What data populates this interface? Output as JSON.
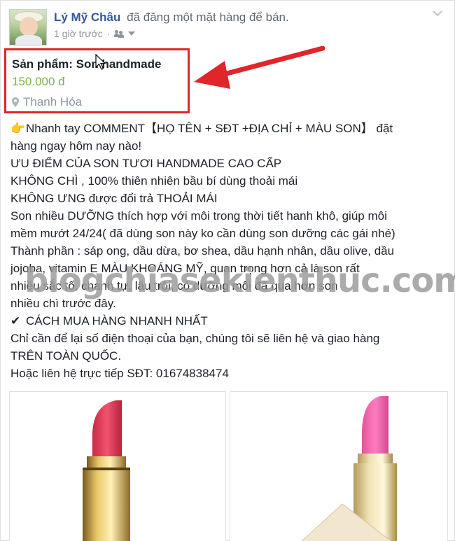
{
  "post": {
    "author": "Lý Mỹ Châu",
    "action": "đã đăng một mặt hàng để bán.",
    "time": "1 giờ trước",
    "separator": "·"
  },
  "product": {
    "title": "Sản phẩm: Son handmade",
    "price": "150.000 đ",
    "location": "Thanh Hóa"
  },
  "body_lines": [
    "Nhanh tay COMMENT【HỌ TÊN + SĐT +ĐỊA CHỈ + MÀU SON】 đặt",
    "hàng ngay hôm nay nào!",
    "ƯU ĐIỂM CỦA SON TƯƠI HANDMADE CAO CẤP",
    "KHÔNG CHÌ , 100% thiên nhiên bầu bí dùng thoải mái",
    "KHÔNG ƯNG được đổi trả THOẢI MÁI",
    "Son nhiều DƯỠNG thích hợp với môi trong thời tiết hanh khô, giúp môi",
    "mềm mướt 24/24( đã dùng son này ko cần dùng son dưỡng các gái nhé)",
    "Thành phần : sáp ong, dầu dừa, bơ shea, dầu hạnh nhân, dầu olive, dầu",
    "jojoba, vitamin E MÀU KHOÁNG MỸ, quan trọng hơn cả là son rất",
    "nhiều sắc tố, chanh tự, lâu trôi, có dưỡng môi đã qua hơn son",
    "nhiều chì trước đây.",
    "CÁCH MUA HÀNG NHANH NHẤT",
    "Chỉ cần để lại số điện thoại của bạn, chúng tôi sẽ liên hệ và giao hàng",
    "TRÊN TOÀN QUỐC.",
    "Hoặc liên hệ trực tiếp SĐT: 01674838474"
  ],
  "watermark": "blogchiasekienthuc.com",
  "icons": {
    "pointing": "pointing-hand-icon",
    "check": "check-mark-icon",
    "location": "location-pin-icon",
    "audience": "friends-icon",
    "menu": "chevron-down-icon"
  },
  "colors": {
    "name": "#365899",
    "price": "#7cb342",
    "highlight": "#e0262b",
    "lipstick_left": "#e8415c",
    "lipstick_right": "#f06ab0"
  }
}
